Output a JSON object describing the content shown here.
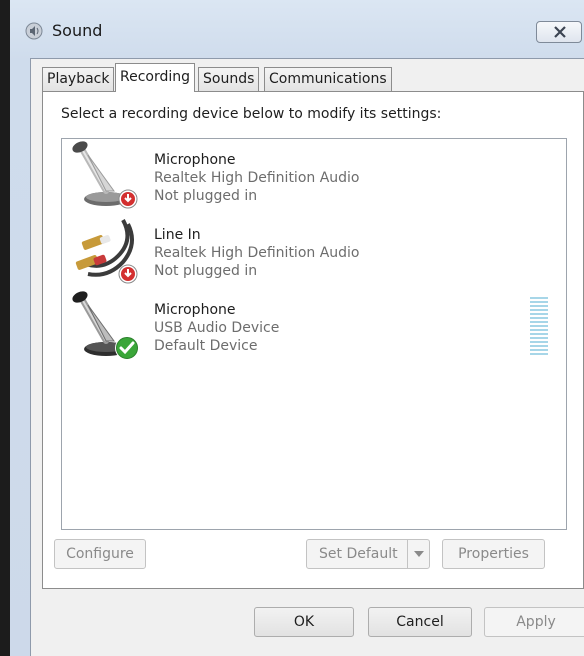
{
  "window": {
    "title": "Sound",
    "title_icon": "speaker-icon",
    "close_icon": "close-icon"
  },
  "tabs": [
    {
      "label": "Playback",
      "active": false
    },
    {
      "label": "Recording",
      "active": true
    },
    {
      "label": "Sounds",
      "active": false
    },
    {
      "label": "Communications",
      "active": false
    }
  ],
  "recording": {
    "instruction": "Select a recording device below to modify its settings:",
    "devices": [
      {
        "name": "Microphone",
        "driver": "Realtek High Definition Audio",
        "status": "Not plugged in",
        "icon": "microphone-icon",
        "badge": "unplugged-badge-icon"
      },
      {
        "name": "Line In",
        "driver": "Realtek High Definition Audio",
        "status": "Not plugged in",
        "icon": "line-in-cable-icon",
        "badge": "unplugged-badge-icon"
      },
      {
        "name": "Microphone",
        "driver": "USB Audio Device",
        "status": "Default Device",
        "icon": "microphone-icon",
        "badge": "default-check-icon"
      }
    ],
    "level_meter_bars": 15,
    "buttons": {
      "configure": "Configure",
      "set_default": "Set Default",
      "properties": "Properties"
    }
  },
  "dialog_buttons": {
    "ok": "OK",
    "cancel": "Cancel",
    "apply": "Apply"
  },
  "colors": {
    "unplugged_badge": "#d32f2f",
    "default_badge": "#3aa639",
    "level_meter": "#a7d6e8"
  }
}
